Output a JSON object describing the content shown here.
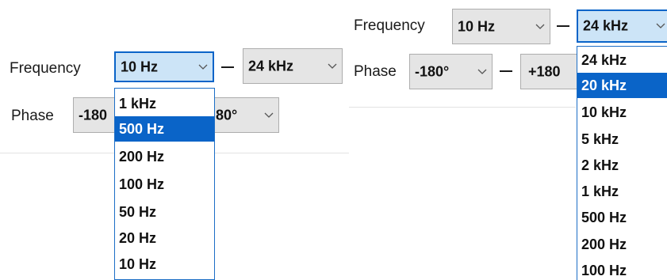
{
  "left": {
    "frequency_label": "Frequency",
    "freq_from": "10 Hz",
    "freq_to": "24 kHz",
    "phase_label": "Phase",
    "phase_from_partial": "-180",
    "phase_to_partial": "80°",
    "dropdown": {
      "selected_index": 1,
      "options": [
        "1 kHz",
        "500 Hz",
        "200 Hz",
        "100 Hz",
        "50 Hz",
        "20 Hz",
        "10 Hz"
      ]
    }
  },
  "right": {
    "frequency_label": "Frequency",
    "freq_from": "10 Hz",
    "freq_to": "24 kHz",
    "phase_label": "Phase",
    "phase_from": "-180°",
    "phase_to_partial": "+180",
    "dropdown": {
      "selected_index": 1,
      "options": [
        "24 kHz",
        "20 kHz",
        "10 kHz",
        "5 kHz",
        "2 kHz",
        "1 kHz",
        "500 Hz",
        "200 Hz",
        "100 Hz"
      ]
    }
  },
  "colors": {
    "accent": "#0a64c8",
    "focus_fill": "#cce4f7",
    "combo_fill": "#e5e5e5"
  }
}
